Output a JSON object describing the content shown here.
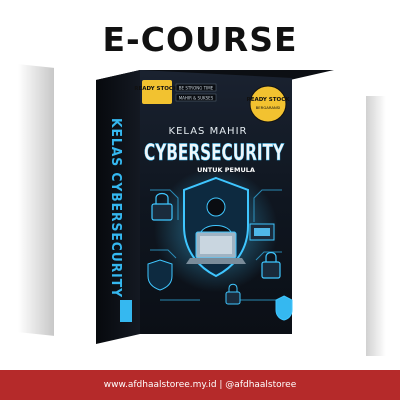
{
  "heading": "E-COURSE",
  "product": {
    "spine_title": "KELAS CYBERSECURITY",
    "top_line": "KELAS MAHIR",
    "main_title": "CYBERSECURITY",
    "subtitle": "UNTUK PEMULA",
    "badge_left": "READY STOCK!",
    "badge_right": "READY STOCK",
    "badge_right_sub": "BERGARANSI",
    "tag_small": "BE STRONG TIME",
    "tag_small_2": "MAHIR & SUKSES"
  },
  "footer": {
    "text": "www.afdhaalstoree.my.id | @afdhaalstoree"
  },
  "colors": {
    "footer_bg": "#b52a2a",
    "accent_blue": "#35b8f0",
    "badge_yellow": "#f2c230",
    "box_dark": "#10131a"
  }
}
